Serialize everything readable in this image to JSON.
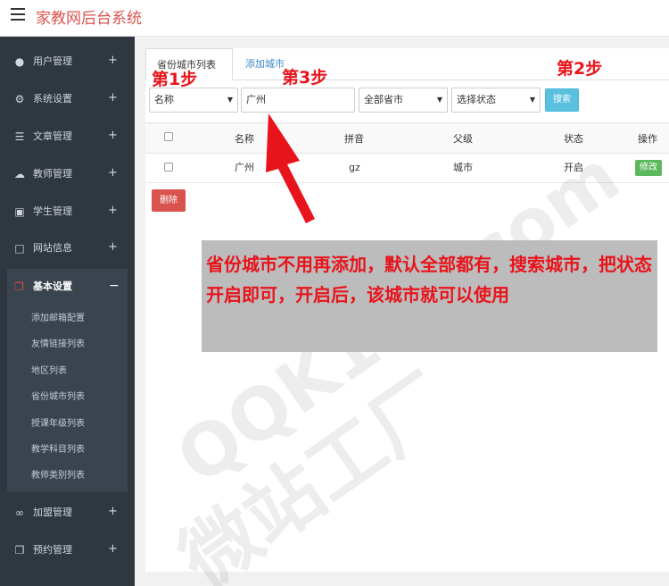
{
  "app": {
    "title": "家教网后台系统"
  },
  "sidebar": {
    "items": [
      {
        "label": "用户管理",
        "icon": "users-icon",
        "toggle": "+"
      },
      {
        "label": "系统设置",
        "icon": "gears-icon",
        "toggle": "+"
      },
      {
        "label": "文章管理",
        "icon": "list-icon",
        "toggle": "+"
      },
      {
        "label": "教师管理",
        "icon": "cloud-icon",
        "toggle": "+"
      },
      {
        "label": "学生管理",
        "icon": "save-icon",
        "toggle": "+"
      },
      {
        "label": "网站信息",
        "icon": "file-icon",
        "toggle": "+"
      },
      {
        "label": "基本设置",
        "icon": "copy-icon",
        "toggle": "−"
      },
      {
        "label": "加盟管理",
        "icon": "chain-icon",
        "toggle": "+"
      },
      {
        "label": "预约管理",
        "icon": "copy-icon",
        "toggle": "+"
      }
    ],
    "submenu": [
      "添加邮箱配置",
      "友情链接列表",
      "地区列表",
      "省份城市列表",
      "授课年级列表",
      "教学科目列表",
      "教师类别列表"
    ]
  },
  "tabs": {
    "active": "省份城市列表",
    "add": "添加城市"
  },
  "filters": {
    "field_select": "名称",
    "search_value": "广州",
    "province_select": "全部省市",
    "status_select": "选择状态",
    "search_button": "搜索"
  },
  "table": {
    "headers": [
      "名称",
      "拼音",
      "父级",
      "状态",
      "操作"
    ],
    "rows": [
      {
        "name": "广州",
        "pinyin": "gz",
        "parent": "城市",
        "status": "开启",
        "action": "修改"
      }
    ]
  },
  "delete_button": "删除",
  "annotations": {
    "step1": "第1步",
    "step2": "第2步",
    "step3": "第3步",
    "note": "省份城市不用再添加，默认全部都有，搜索城市，把状态开启即可，开启后，该城市就可以使用"
  },
  "watermark": {
    "line1": "QQK100.com",
    "line2": "微站工厂"
  },
  "colors": {
    "sidebar": "#2f3740",
    "danger": "#d9534f",
    "info": "#5bc0de",
    "success": "#5cb85c",
    "annotation": "#e8141b"
  }
}
